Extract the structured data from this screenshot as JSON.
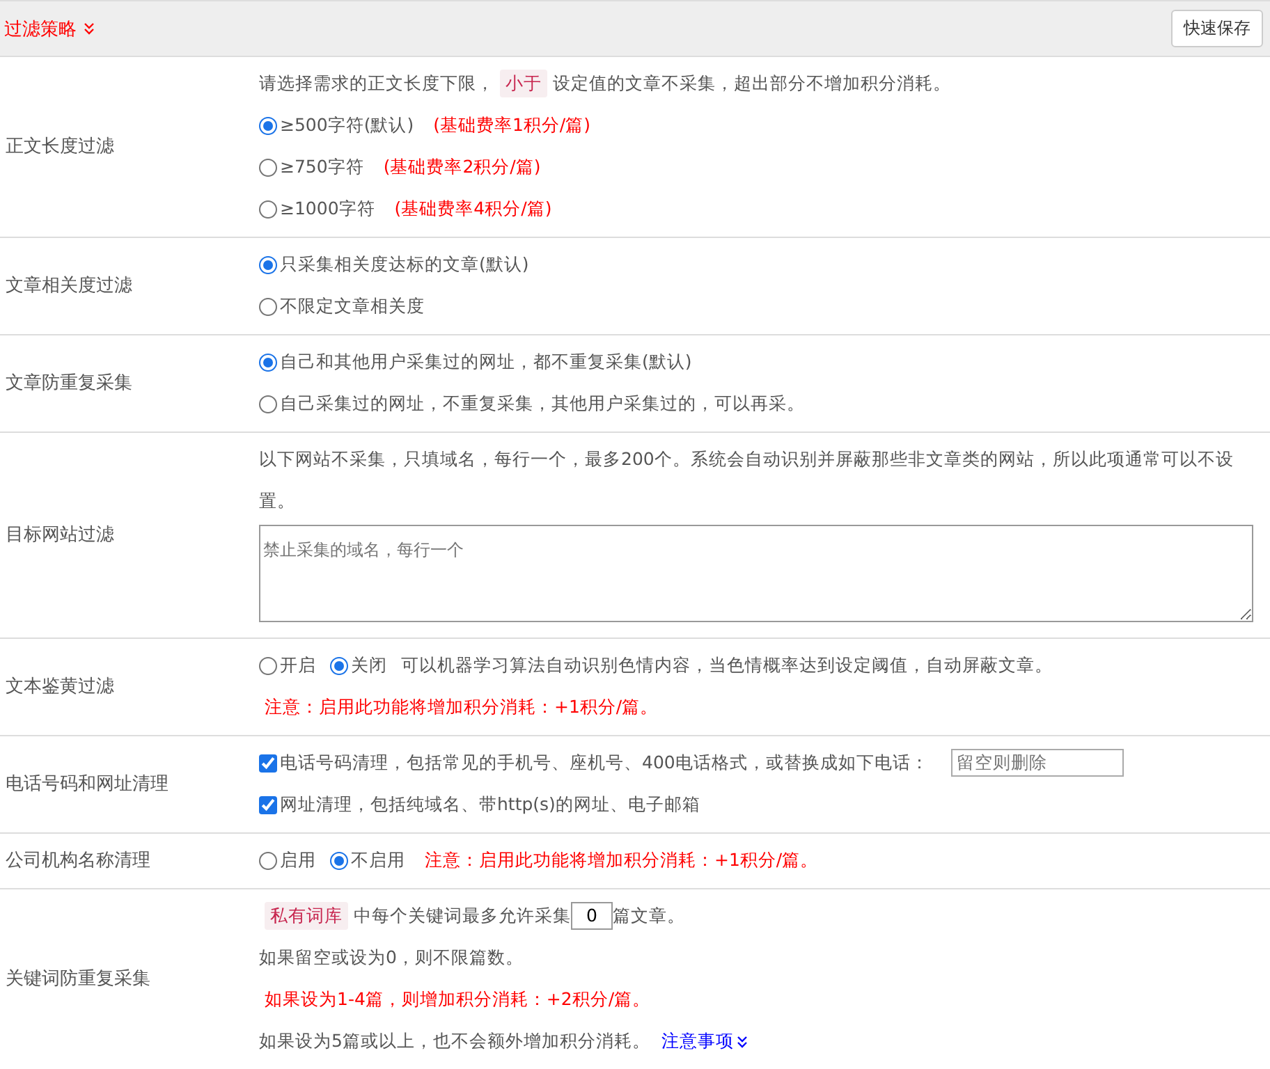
{
  "header": {
    "title": "过滤策略",
    "save_button": "快速保存"
  },
  "rows": [
    {
      "label": "正文长度过滤",
      "lines": [
        [
          {
            "kind": "text",
            "text": "请选择需求的正文长度下限，"
          },
          {
            "kind": "tag",
            "text": "小于"
          },
          {
            "kind": "text",
            "text": "设定值的文章不采集，超出部分不增加积分消耗。"
          }
        ],
        [
          {
            "kind": "radio",
            "text": "≥500字符(默认)",
            "selected": true
          },
          {
            "kind": "warn",
            "text": "(基础费率1积分/篇)"
          }
        ],
        [
          {
            "kind": "radio",
            "text": "≥750字符",
            "selected": false
          },
          {
            "kind": "warn",
            "text": "(基础费率2积分/篇)"
          }
        ],
        [
          {
            "kind": "radio",
            "text": "≥1000字符",
            "selected": false
          },
          {
            "kind": "warn",
            "text": "(基础费率4积分/篇)"
          }
        ]
      ]
    },
    {
      "label": "文章相关度过滤",
      "lines": [
        [
          {
            "kind": "radio",
            "text": "只采集相关度达标的文章(默认)",
            "selected": true
          }
        ],
        [
          {
            "kind": "radio",
            "text": "不限定文章相关度",
            "selected": false
          }
        ]
      ]
    },
    {
      "label": "文章防重复采集",
      "lines": [
        [
          {
            "kind": "radio",
            "text": "自己和其他用户采集过的网址，都不重复采集(默认)",
            "selected": true
          }
        ],
        [
          {
            "kind": "radio",
            "text": "自己采集过的网址，不重复采集，其他用户采集过的，可以再采。",
            "selected": false
          }
        ]
      ]
    },
    {
      "label": "目标网站过滤",
      "lines": [
        [
          {
            "kind": "text",
            "text": "以下网站不采集，只填域名，每行一个，最多200个。系统会自动识别并屏蔽那些非文章类的网站，所以此项通常可以不设置。"
          }
        ],
        [
          {
            "kind": "textarea",
            "placeholder": "禁止采集的域名，每行一个"
          }
        ]
      ]
    },
    {
      "label": "文本鉴黄过滤",
      "lines": [
        [
          {
            "kind": "radio",
            "text": "开启",
            "selected": false
          },
          {
            "kind": "radio",
            "text": "关闭",
            "selected": true
          },
          {
            "kind": "text",
            "text": "可以机器学习算法自动识别色情内容，当色情概率达到设定阈值，自动屏蔽文章。"
          }
        ],
        [
          {
            "kind": "warn",
            "text": "注意：启用此功能将增加积分消耗：+1积分/篇。"
          }
        ]
      ]
    },
    {
      "label": "电话号码和网址清理",
      "lines": [
        [
          {
            "kind": "checkbox",
            "text": "电话号码清理，包括常见的手机号、座机号、400电话格式，或替换成如下电话：",
            "checked": true
          },
          {
            "kind": "input",
            "placeholder": "留空则删除"
          }
        ],
        [
          {
            "kind": "checkbox",
            "text": "网址清理，包括纯域名、带http(s)的网址、电子邮箱",
            "checked": true
          }
        ]
      ]
    },
    {
      "label": "公司机构名称清理",
      "lines": [
        [
          {
            "kind": "radio",
            "text": "启用",
            "selected": false
          },
          {
            "kind": "radio",
            "text": "不启用",
            "selected": true
          },
          {
            "kind": "warn",
            "text": "注意：启用此功能将增加积分消耗：+1积分/篇。"
          }
        ]
      ]
    },
    {
      "label": "关键词防重复采集",
      "lines": [
        [
          {
            "kind": "tag",
            "text": "私有词库"
          },
          {
            "kind": "text",
            "text": "中每个关键词最多允许采集"
          },
          {
            "kind": "number",
            "value": "0"
          },
          {
            "kind": "text",
            "text": "篇文章。"
          }
        ],
        [
          {
            "kind": "text",
            "text": "如果留空或设为0，则不限篇数。"
          }
        ],
        [
          {
            "kind": "warn",
            "text": "如果设为1-4篇，则增加积分消耗：+2积分/篇。"
          }
        ],
        [
          {
            "kind": "text",
            "text": "如果设为5篇或以上，也不会额外增加积分消耗。"
          },
          {
            "kind": "link",
            "text": "注意事项"
          }
        ]
      ]
    }
  ]
}
